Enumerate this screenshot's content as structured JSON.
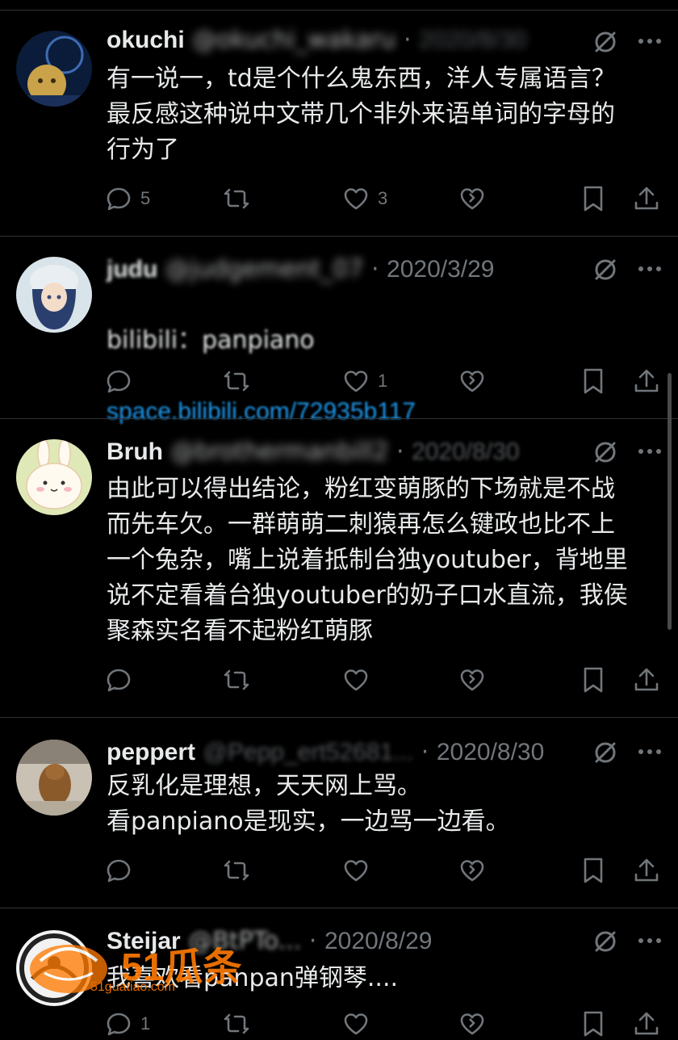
{
  "colors": {
    "background": "#000000",
    "text": "#e7e9ea",
    "secondary": "#71767b",
    "link": "#1d9bf0",
    "divider": "#2f3336",
    "watermark": "#ff7a00"
  },
  "tweets": [
    {
      "name": "okuchi",
      "handle_blurred": "@okuchi_wakaru",
      "date": "2020/8/30",
      "body": "有一说一，td是个什么鬼东西，洋人专属语言？\n最反感这种说中文带几个非外来语单词的字母的\n行为了",
      "reply_count": "5",
      "retweet_count": "",
      "like_count": "3"
    },
    {
      "name": "judu",
      "handle_blurred": "@judgement_07",
      "date": "2020/3/29",
      "body": "bilibili：panpiano",
      "link": "space.bilibili.com/72935b117",
      "reply_count": "",
      "retweet_count": "",
      "like_count": "1"
    },
    {
      "name": "Bruh",
      "handle_blurred": "@brothermanbill2",
      "date": "2020/8/30",
      "body": "由此可以得出结论，粉红变萌豚的下场就是不战\n而先车欠。一群萌萌二刺猿再怎么键政也比不上\n一个兔杂，嘴上说着抵制台独youtuber，背地里\n说不定看着台独youtuber的奶子口水直流，我侯\n聚森实名看不起粉红萌豚",
      "reply_count": "",
      "retweet_count": "",
      "like_count": ""
    },
    {
      "name": "peppert",
      "handle_blurred": "@Pepp_ert52681...",
      "date": "2020/8/30",
      "body": "反乳化是理想，天天网上骂。\n看panpiano是现实，一边骂一边看。",
      "reply_count": "",
      "retweet_count": "",
      "like_count": ""
    },
    {
      "name": "Steijar",
      "handle_blurred": "@BtPTo...",
      "date": "2020/8/29",
      "body": "我喜欢看panpan弹钢琴....",
      "reply_count": "1",
      "retweet_count": "",
      "like_count": ""
    }
  ],
  "icons": {
    "reply": "reply-icon",
    "retweet": "retweet-icon",
    "like": "like-icon",
    "grok": "grok-icon",
    "bookmark": "bookmark-icon",
    "share": "share-icon",
    "more": "more-icon"
  },
  "watermark": {
    "logo_text": "51瓜条",
    "site": "51guatiao.com"
  }
}
